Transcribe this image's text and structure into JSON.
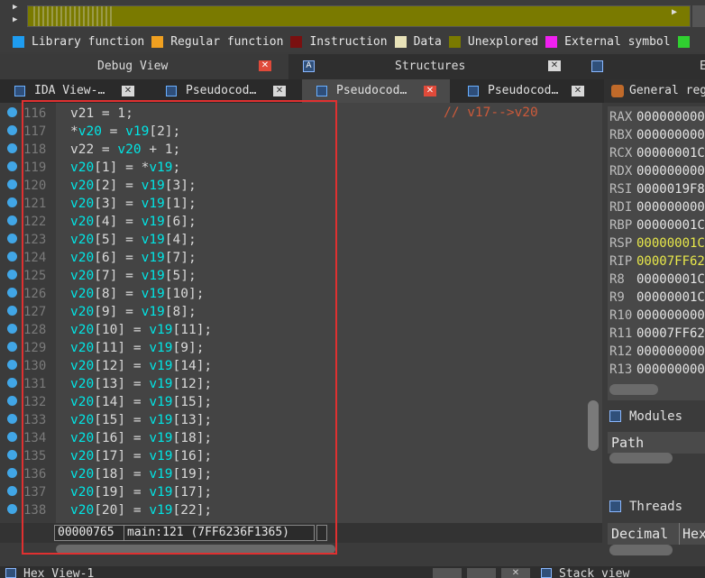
{
  "navbar": {
    "left_arrow": "▶",
    "right_arrow": "▶"
  },
  "legend": [
    {
      "label": "Library function",
      "color": "#1e9cf0"
    },
    {
      "label": "Regular function",
      "color": "#f0a020"
    },
    {
      "label": "Instruction",
      "color": "#7a1010"
    },
    {
      "label": "Data",
      "color": "#e8e2b8"
    },
    {
      "label": "Unexplored",
      "color": "#7a7a00"
    },
    {
      "label": "External symbol",
      "color": "#f020f0"
    },
    {
      "label": "",
      "color": "#30d030"
    }
  ],
  "panels": {
    "debug_view": "Debug View",
    "structures": "Structures",
    "structures_icon": "A",
    "right_stub": "E",
    "close_glyph": "✕"
  },
  "tabs": [
    {
      "label": "IDA View-…"
    },
    {
      "label": "Pseudocod…"
    },
    {
      "label": "Pseudocod…"
    },
    {
      "label": "Pseudocod…"
    }
  ],
  "editor": {
    "comment": "// v17-->v20",
    "lines": [
      {
        "num": "116",
        "code": [
          [
            "n",
            "v21 = 1;"
          ]
        ]
      },
      {
        "num": "117",
        "code": [
          [
            "n",
            "*"
          ],
          [
            "v",
            "v20"
          ],
          [
            "n",
            " = "
          ],
          [
            "v",
            "v19"
          ],
          [
            "n",
            "[2];"
          ]
        ]
      },
      {
        "num": "118",
        "code": [
          [
            "n",
            "v22 = "
          ],
          [
            "v",
            "v20"
          ],
          [
            "n",
            " + 1;"
          ]
        ]
      },
      {
        "num": "119",
        "code": [
          [
            "v",
            "v20"
          ],
          [
            "n",
            "[1] = *"
          ],
          [
            "v",
            "v19"
          ],
          [
            "n",
            ";"
          ]
        ]
      },
      {
        "num": "120",
        "code": [
          [
            "v",
            "v20"
          ],
          [
            "n",
            "[2] = "
          ],
          [
            "v",
            "v19"
          ],
          [
            "n",
            "[3];"
          ]
        ]
      },
      {
        "num": "121",
        "code": [
          [
            "v",
            "v20"
          ],
          [
            "n",
            "[3] = "
          ],
          [
            "v",
            "v19"
          ],
          [
            "n",
            "[1];"
          ]
        ]
      },
      {
        "num": "122",
        "code": [
          [
            "v",
            "v20"
          ],
          [
            "n",
            "[4] = "
          ],
          [
            "v",
            "v19"
          ],
          [
            "n",
            "[6];"
          ]
        ]
      },
      {
        "num": "123",
        "code": [
          [
            "v",
            "v20"
          ],
          [
            "n",
            "[5] = "
          ],
          [
            "v",
            "v19"
          ],
          [
            "n",
            "[4];"
          ]
        ]
      },
      {
        "num": "124",
        "code": [
          [
            "v",
            "v20"
          ],
          [
            "n",
            "[6] = "
          ],
          [
            "v",
            "v19"
          ],
          [
            "n",
            "[7];"
          ]
        ]
      },
      {
        "num": "125",
        "code": [
          [
            "v",
            "v20"
          ],
          [
            "n",
            "[7] = "
          ],
          [
            "v",
            "v19"
          ],
          [
            "n",
            "[5];"
          ]
        ]
      },
      {
        "num": "126",
        "code": [
          [
            "v",
            "v20"
          ],
          [
            "n",
            "[8] = "
          ],
          [
            "v",
            "v19"
          ],
          [
            "n",
            "[10];"
          ]
        ]
      },
      {
        "num": "127",
        "code": [
          [
            "v",
            "v20"
          ],
          [
            "n",
            "[9] = "
          ],
          [
            "v",
            "v19"
          ],
          [
            "n",
            "[8];"
          ]
        ]
      },
      {
        "num": "128",
        "code": [
          [
            "v",
            "v20"
          ],
          [
            "n",
            "[10] = "
          ],
          [
            "v",
            "v19"
          ],
          [
            "n",
            "[11];"
          ]
        ]
      },
      {
        "num": "129",
        "code": [
          [
            "v",
            "v20"
          ],
          [
            "n",
            "[11] = "
          ],
          [
            "v",
            "v19"
          ],
          [
            "n",
            "[9];"
          ]
        ]
      },
      {
        "num": "130",
        "code": [
          [
            "v",
            "v20"
          ],
          [
            "n",
            "[12] = "
          ],
          [
            "v",
            "v19"
          ],
          [
            "n",
            "[14];"
          ]
        ]
      },
      {
        "num": "131",
        "code": [
          [
            "v",
            "v20"
          ],
          [
            "n",
            "[13] = "
          ],
          [
            "v",
            "v19"
          ],
          [
            "n",
            "[12];"
          ]
        ]
      },
      {
        "num": "132",
        "code": [
          [
            "v",
            "v20"
          ],
          [
            "n",
            "[14] = "
          ],
          [
            "v",
            "v19"
          ],
          [
            "n",
            "[15];"
          ]
        ]
      },
      {
        "num": "133",
        "code": [
          [
            "v",
            "v20"
          ],
          [
            "n",
            "[15] = "
          ],
          [
            "v",
            "v19"
          ],
          [
            "n",
            "[13];"
          ]
        ]
      },
      {
        "num": "134",
        "code": [
          [
            "v",
            "v20"
          ],
          [
            "n",
            "[16] = "
          ],
          [
            "v",
            "v19"
          ],
          [
            "n",
            "[18];"
          ]
        ]
      },
      {
        "num": "135",
        "code": [
          [
            "v",
            "v20"
          ],
          [
            "n",
            "[17] = "
          ],
          [
            "v",
            "v19"
          ],
          [
            "n",
            "[16];"
          ]
        ]
      },
      {
        "num": "136",
        "code": [
          [
            "v",
            "v20"
          ],
          [
            "n",
            "[18] = "
          ],
          [
            "v",
            "v19"
          ],
          [
            "n",
            "[19];"
          ]
        ]
      },
      {
        "num": "137",
        "code": [
          [
            "v",
            "v20"
          ],
          [
            "n",
            "[19] = "
          ],
          [
            "v",
            "v19"
          ],
          [
            "n",
            "[17];"
          ]
        ]
      },
      {
        "num": "138",
        "code": [
          [
            "v",
            "v20"
          ],
          [
            "n",
            "[20] = "
          ],
          [
            "v",
            "v19"
          ],
          [
            "n",
            "[22];"
          ]
        ]
      }
    ]
  },
  "status": {
    "address": "00000765",
    "location": "main:121 (7FF6236F1365)"
  },
  "registers": {
    "title": "General reg",
    "rows": [
      {
        "name": "RAX",
        "value": "000000000"
      },
      {
        "name": "RBX",
        "value": "000000000"
      },
      {
        "name": "RCX",
        "value": "00000001C"
      },
      {
        "name": "RDX",
        "value": "000000000"
      },
      {
        "name": "RSI",
        "value": "0000019F8"
      },
      {
        "name": "RDI",
        "value": "000000000"
      },
      {
        "name": "RBP",
        "value": "00000001C"
      },
      {
        "name": "RSP",
        "value": "00000001C",
        "highlight": true
      },
      {
        "name": "RIP",
        "value": "00007FF62",
        "highlight": true
      },
      {
        "name": "R8",
        "value": "00000001C"
      },
      {
        "name": "R9",
        "value": "00000001C"
      },
      {
        "name": "R10",
        "value": "000000000"
      },
      {
        "name": "R11",
        "value": "00007FF62"
      },
      {
        "name": "R12",
        "value": "000000000"
      },
      {
        "name": "R13",
        "value": "000000000"
      }
    ]
  },
  "modules": {
    "title": "Modules",
    "column": "Path"
  },
  "threads": {
    "title": "Threads",
    "columns": [
      "Decimal",
      "Hex"
    ]
  },
  "bottom": {
    "hex_view": "Hex View-1",
    "stack_view": "Stack view"
  }
}
